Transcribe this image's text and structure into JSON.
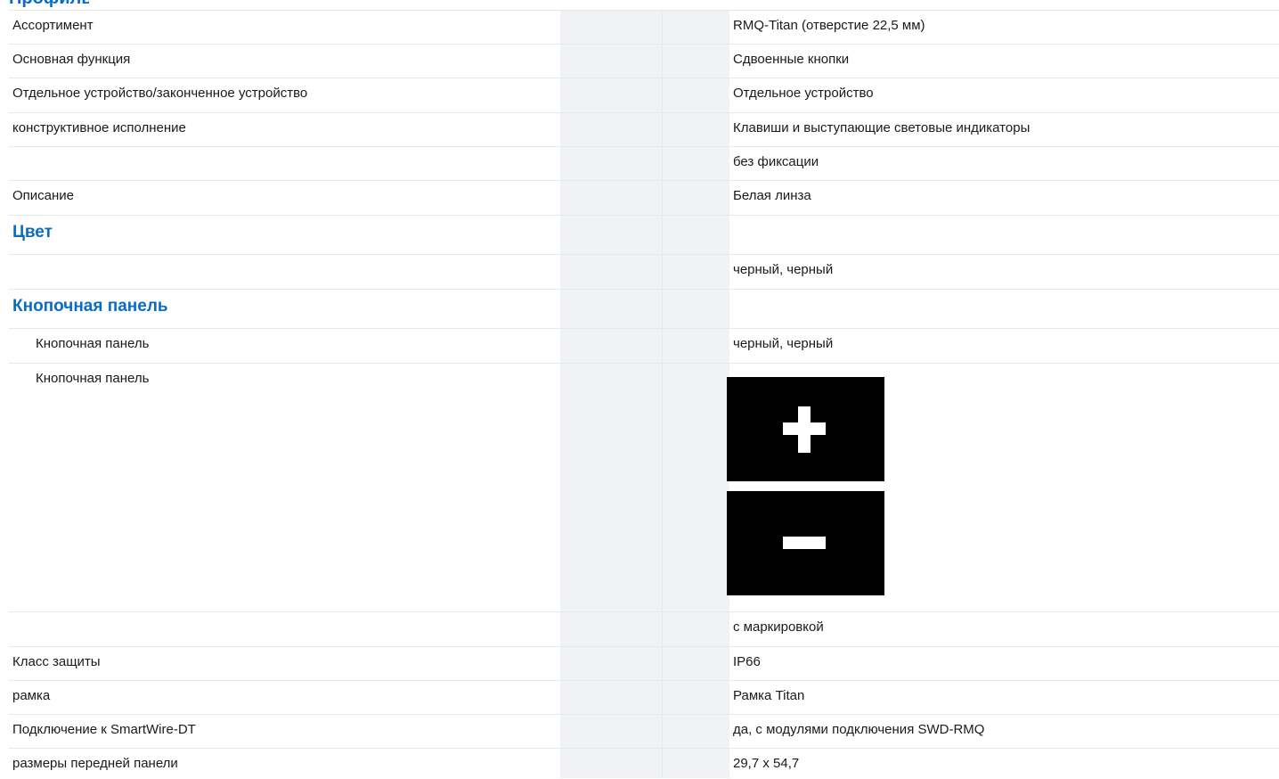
{
  "header": {
    "title": "Профиль"
  },
  "rows": [
    {
      "label": "Ассортимент",
      "value": "RMQ-Titan (отверстие 22,5 мм)"
    },
    {
      "label": "Основная функция",
      "value": "Сдвоенные кнопки"
    },
    {
      "label": "Отдельное устройство/законченное устройство",
      "value": "Отдельное устройство"
    },
    {
      "label": "конструктивное исполнение",
      "value": "Клавиши и выступающие световые индикаторы"
    },
    {
      "label": "",
      "value": "без фиксации"
    },
    {
      "label": "Описание",
      "value": "Белая линза"
    }
  ],
  "section_color": {
    "title": "Цвет",
    "value": "черный, черный"
  },
  "section_panel": {
    "title": "Кнопочная панель",
    "row1": {
      "label": "Кнопочная панель",
      "value": "черный, черный"
    },
    "row2": {
      "label": "Кнопочная панель",
      "image_buttons": [
        "plus-icon",
        "minus-icon"
      ]
    },
    "row3": {
      "label": "",
      "value": "с маркировкой"
    }
  },
  "tail_rows": [
    {
      "label": "Класс защиты",
      "value": "IP66"
    },
    {
      "label": "рамка",
      "value": "Рамка Titan"
    },
    {
      "label": "Подключение к SmartWire-DT",
      "value": "да, с модулями подключения SWD-RMQ"
    },
    {
      "label": "размеры передней панели",
      "value": "29,7 x 54,7"
    }
  ],
  "colors": {
    "accent": "#0b6cc4",
    "shade": "#f0f2f5",
    "border": "#e4e7eb"
  }
}
